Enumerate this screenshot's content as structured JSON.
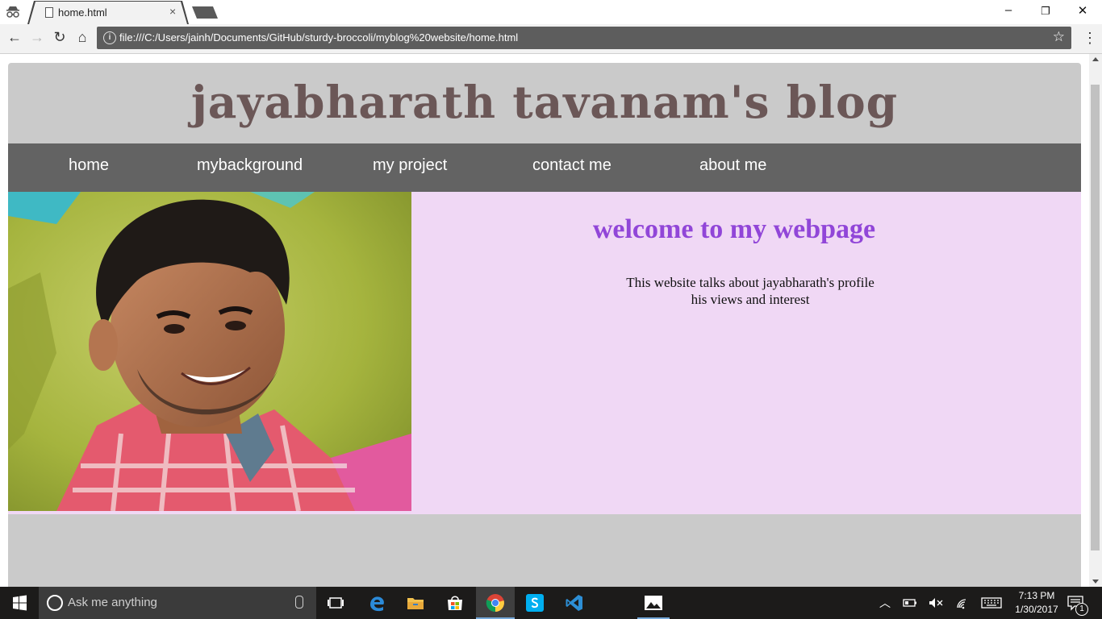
{
  "browser": {
    "tab_title": "home.html",
    "tab_close": "×",
    "url": "file:///C:/Users/jainh/Documents/GitHub/sturdy-broccoli/myblog%20website/home.html",
    "window_controls": {
      "minimize": "–",
      "restore": "❐",
      "close": "✕"
    },
    "nav": {
      "back": "←",
      "forward": "→",
      "reload": "↻",
      "home": "⌂"
    },
    "info": "i",
    "bookmark": "☆",
    "menu": "⋮"
  },
  "site": {
    "title": "jayabharath tavanam's blog",
    "nav": [
      "home",
      "mybackground",
      "my project",
      "contact me",
      "about me"
    ],
    "welcome": "welcome to my webpage",
    "intro_line1": "This website talks about jayabharath's profile",
    "intro_line2": "his views and interest"
  },
  "taskbar": {
    "search_placeholder": "Ask me anything",
    "time": "7:13 PM",
    "date": "1/30/2017",
    "notifications": "1"
  },
  "colors": {
    "page_bg": "#cacaca",
    "title": "#6b5757",
    "nav_bg": "#636363",
    "content_bg": "#f0d8f5",
    "welcome": "#9146d8"
  }
}
